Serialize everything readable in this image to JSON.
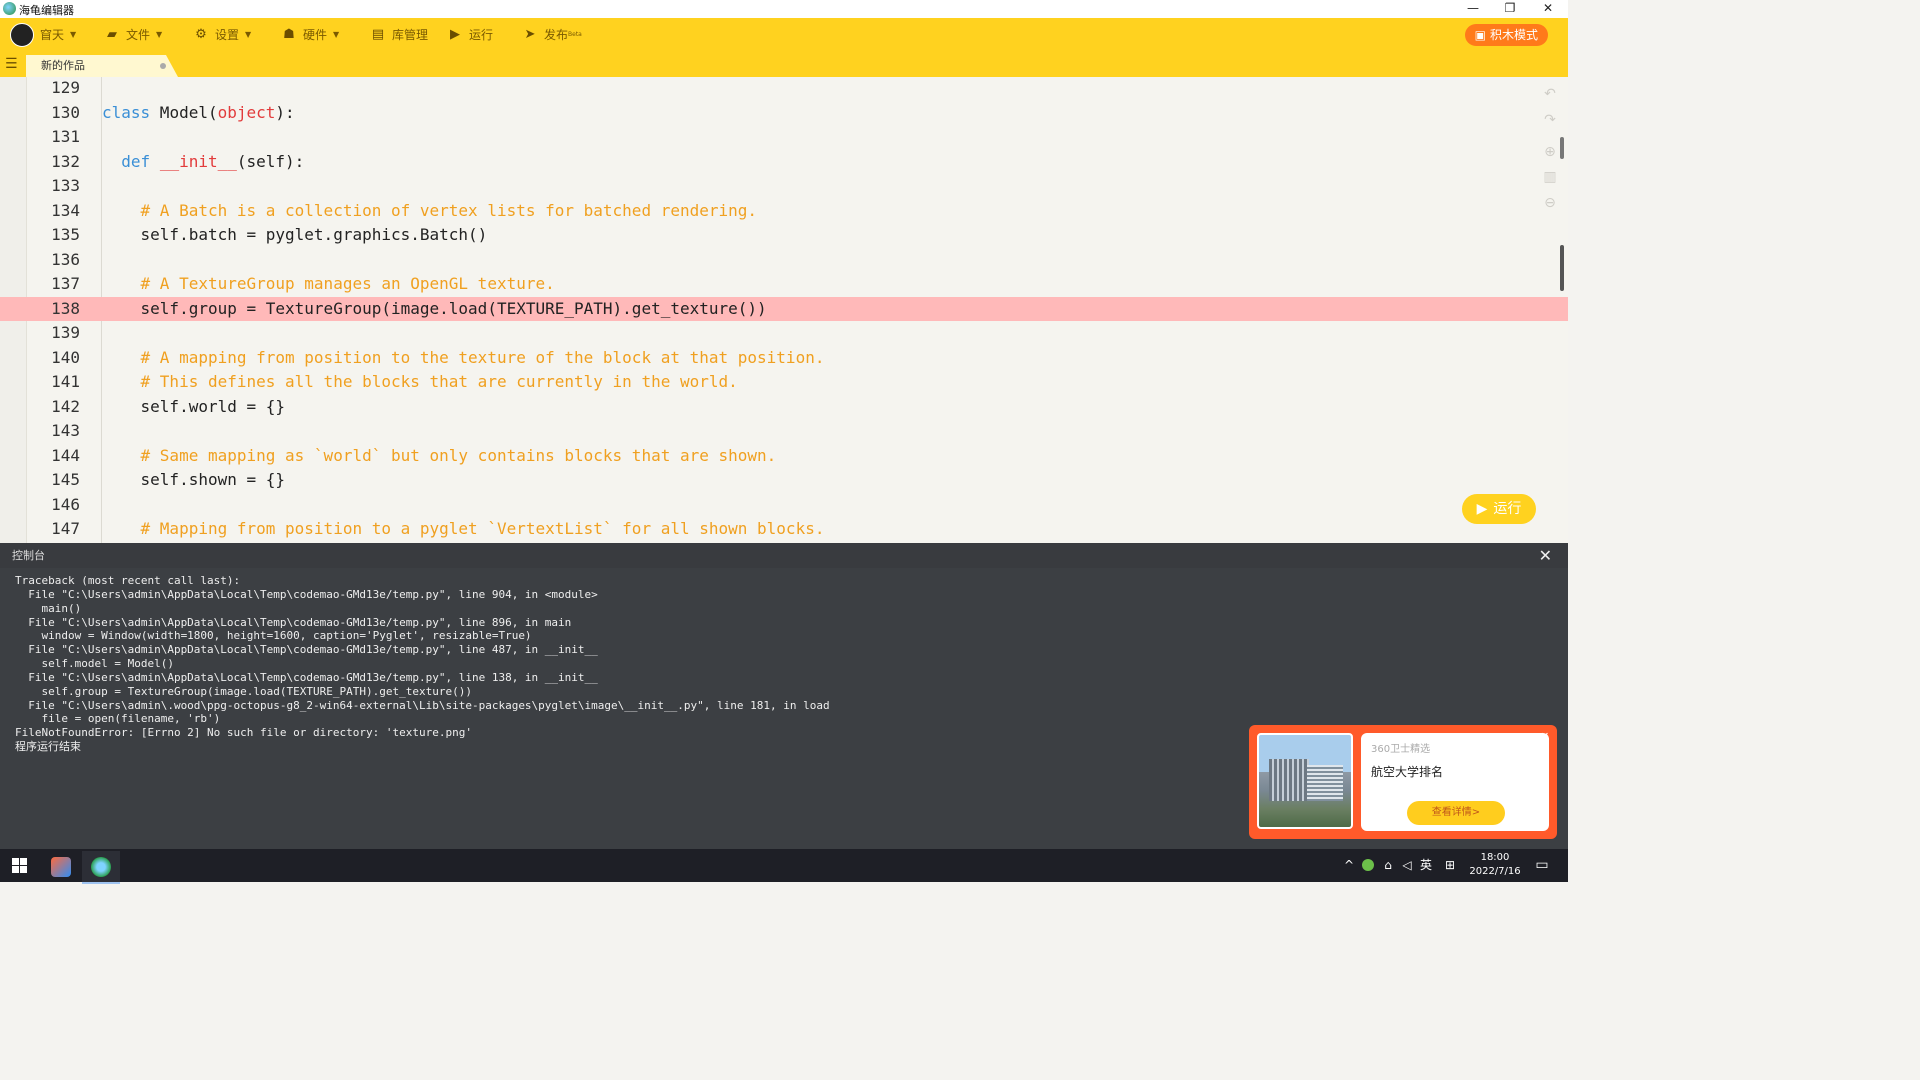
{
  "window": {
    "title": "海龟编辑器",
    "controls": {
      "minimize": "—",
      "restore": "❐",
      "close": "✕"
    }
  },
  "toolbar": {
    "user": {
      "label": "窅天"
    },
    "file": {
      "label": "文件"
    },
    "settings": {
      "label": "设置"
    },
    "hardware": {
      "label": "硬件"
    },
    "library": {
      "label": "库管理"
    },
    "run": {
      "label": "运行"
    },
    "publish": {
      "label": "发布",
      "superscript": "Beta"
    },
    "block_mode": {
      "label": "积木模式"
    }
  },
  "tabs": [
    {
      "label": "新的作品"
    }
  ],
  "editor": {
    "lines": [
      {
        "num": "129",
        "tokens": []
      },
      {
        "num": "130",
        "tokens": [
          {
            "t": "kw",
            "v": "class"
          },
          {
            "t": "tx",
            "v": " Model("
          },
          {
            "t": "bi",
            "v": "object"
          },
          {
            "t": "tx",
            "v": "):"
          }
        ]
      },
      {
        "num": "131",
        "tokens": []
      },
      {
        "num": "132",
        "tokens": [
          {
            "t": "tx",
            "v": "  "
          },
          {
            "t": "kw",
            "v": "def"
          },
          {
            "t": "tx",
            "v": " "
          },
          {
            "t": "bi",
            "v": "__init__"
          },
          {
            "t": "tx",
            "v": "(self):"
          }
        ]
      },
      {
        "num": "133",
        "tokens": []
      },
      {
        "num": "134",
        "tokens": [
          {
            "t": "tx",
            "v": "    "
          },
          {
            "t": "cm",
            "v": "# A Batch is a collection of vertex lists for batched rendering."
          }
        ]
      },
      {
        "num": "135",
        "tokens": [
          {
            "t": "tx",
            "v": "    self.batch = pyglet.graphics.Batch()"
          }
        ]
      },
      {
        "num": "136",
        "tokens": []
      },
      {
        "num": "137",
        "tokens": [
          {
            "t": "tx",
            "v": "    "
          },
          {
            "t": "cm",
            "v": "# A TextureGroup manages an OpenGL texture."
          }
        ]
      },
      {
        "num": "138",
        "highlight": true,
        "tokens": [
          {
            "t": "tx",
            "v": "    self.group = TextureGroup(image.load(TEXTURE_PATH).get_texture())"
          }
        ]
      },
      {
        "num": "139",
        "tokens": []
      },
      {
        "num": "140",
        "tokens": [
          {
            "t": "tx",
            "v": "    "
          },
          {
            "t": "cm",
            "v": "# A mapping from position to the texture of the block at that position."
          }
        ]
      },
      {
        "num": "141",
        "tokens": [
          {
            "t": "tx",
            "v": "    "
          },
          {
            "t": "cm",
            "v": "# This defines all the blocks that are currently in the world."
          }
        ]
      },
      {
        "num": "142",
        "tokens": [
          {
            "t": "tx",
            "v": "    self.world = {}"
          }
        ]
      },
      {
        "num": "143",
        "tokens": []
      },
      {
        "num": "144",
        "tokens": [
          {
            "t": "tx",
            "v": "    "
          },
          {
            "t": "cm",
            "v": "# Same mapping as `world` but only contains blocks that are shown."
          }
        ]
      },
      {
        "num": "145",
        "tokens": [
          {
            "t": "tx",
            "v": "    self.shown = {}"
          }
        ]
      },
      {
        "num": "146",
        "tokens": []
      },
      {
        "num": "147",
        "tokens": [
          {
            "t": "tx",
            "v": "    "
          },
          {
            "t": "cm",
            "v": "# Mapping from position to a pyglet `VertextList` for all shown blocks."
          }
        ]
      }
    ],
    "run_button": "运行"
  },
  "console": {
    "title": "控制台",
    "close": "✕",
    "lines": [
      "Traceback (most recent call last):",
      "  File \"C:\\Users\\admin\\AppData\\Local\\Temp\\codemao-GMd13e/temp.py\", line 904, in <module>",
      "    main()",
      "  File \"C:\\Users\\admin\\AppData\\Local\\Temp\\codemao-GMd13e/temp.py\", line 896, in main",
      "    window = Window(width=1800, height=1600, caption='Pyglet', resizable=True)",
      "  File \"C:\\Users\\admin\\AppData\\Local\\Temp\\codemao-GMd13e/temp.py\", line 487, in __init__",
      "    self.model = Model()",
      "  File \"C:\\Users\\admin\\AppData\\Local\\Temp\\codemao-GMd13e/temp.py\", line 138, in __init__",
      "    self.group = TextureGroup(image.load(TEXTURE_PATH).get_texture())",
      "  File \"C:\\Users\\admin\\.wood\\ppg-octopus-g8_2-win64-external\\Lib\\site-packages\\pyglet\\image\\__init__.py\", line 181, in load",
      "    file = open(filename, 'rb')",
      "FileNotFoundError: [Errno 2] No such file or directory: 'texture.png'",
      "程序运行结束"
    ]
  },
  "ad": {
    "source": "360卫士精选",
    "title": "航空大学排名",
    "button": "查看详情>",
    "collapse": "⌄",
    "close": "✕"
  },
  "taskbar": {
    "tray": {
      "chevron": "^",
      "ime": "英",
      "grid": "⊞"
    },
    "time": "18:00",
    "date": "2022/7/16"
  },
  "colors": {
    "accent": "#ffd21f",
    "highlight_line": "#ffb9b9",
    "keyword": "#3a8fd6",
    "builtin": "#e23b3b",
    "comment": "#f0a020",
    "console_bg": "#3c3f43"
  }
}
